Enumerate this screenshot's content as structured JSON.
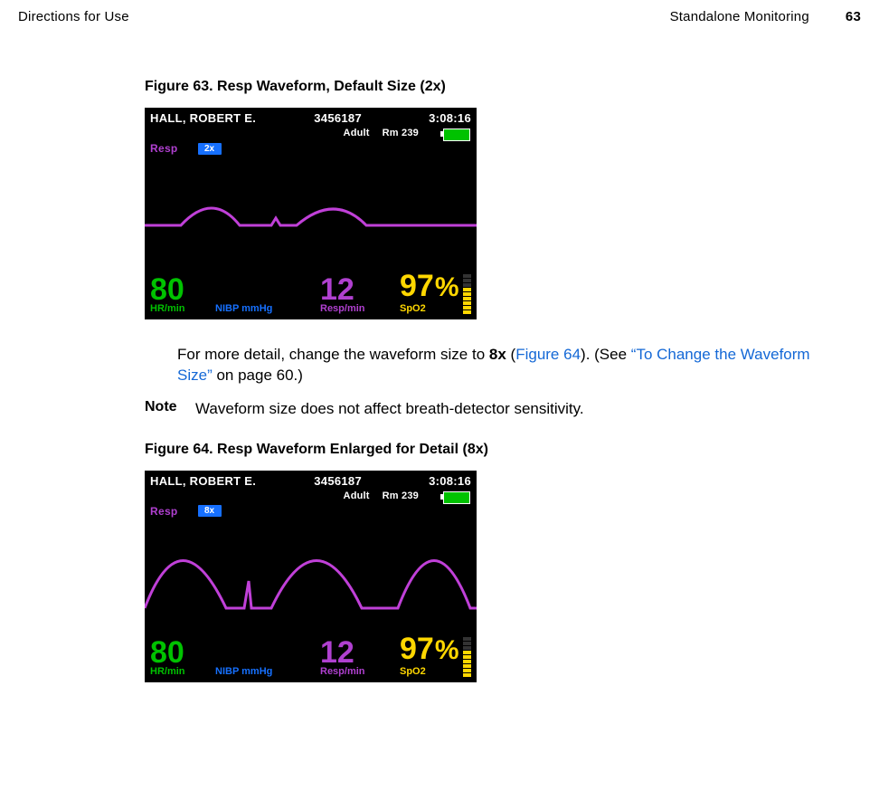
{
  "header": {
    "left": "Directions for Use",
    "center": "Standalone Monitoring",
    "right": "63"
  },
  "fig63": {
    "caption": "Figure 63.  Resp Waveform, Default Size (2x)"
  },
  "fig64": {
    "caption": "Figure 64.  Resp Waveform Enlarged for Detail (8x)"
  },
  "monitor": {
    "patient": "HALL, ROBERT E.",
    "pid": "3456187",
    "time": "3:08:16",
    "mode": "Adult",
    "room": "Rm 239",
    "resp_lbl": "Resp",
    "scale2": "2x",
    "scale8": "8x",
    "hr_val": "80",
    "hr_unit": "HR/min",
    "nibp_unit": "NIBP mmHg",
    "resp_val": "12",
    "resp_unit": "Resp/min",
    "spo2_val": "97",
    "spo2_pct": "%",
    "spo2_lbl": "SpO2"
  },
  "body": {
    "para_a": "For more detail, change the waveform size to ",
    "para_bold": "8x",
    "para_b": " (",
    "para_link1": "Figure 64",
    "para_c": "). (See ",
    "para_link2": "“To Change the Waveform Size”",
    "para_d": " on page 60.)",
    "note_lbl": "Note",
    "note_txt": "Waveform size does not affect breath-detector sensitivity."
  }
}
